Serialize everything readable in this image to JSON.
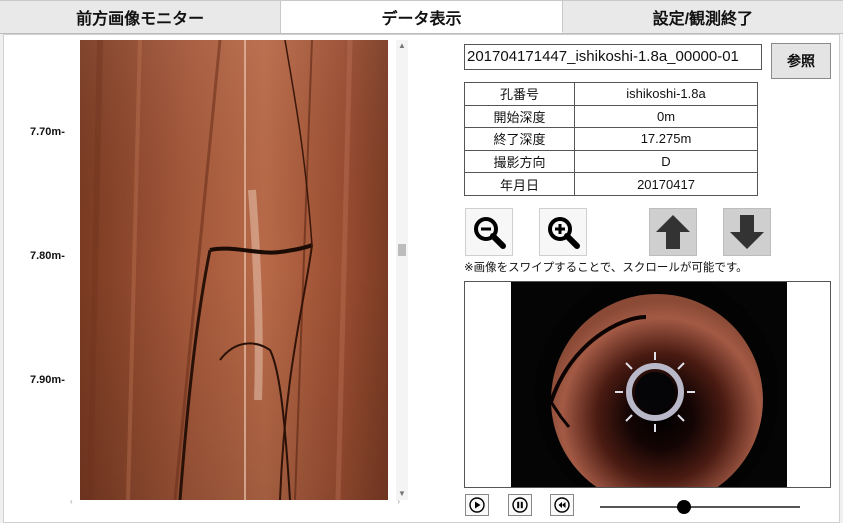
{
  "tabs": [
    {
      "label": "前方画像モニター"
    },
    {
      "label": "データ表示"
    },
    {
      "label": "設定/観測終了"
    }
  ],
  "depth_labels": [
    "7.70m-",
    "7.80m-",
    "7.90m-"
  ],
  "file": {
    "name": "201704171447_ishikoshi-1.8a_00000-01",
    "ref_button": "参照"
  },
  "info_table": [
    {
      "key": "孔番号",
      "value": "ishikoshi-1.8a"
    },
    {
      "key": "開始深度",
      "value": "0m"
    },
    {
      "key": "終了深度",
      "value": "17.275m"
    },
    {
      "key": "撮影方向",
      "value": "D"
    },
    {
      "key": "年月日",
      "value": "20170417"
    }
  ],
  "controls": {
    "zoom_out_icon": "zoom-out-icon",
    "zoom_in_icon": "zoom-in-icon",
    "up_icon": "arrow-up-icon",
    "down_icon": "arrow-down-icon"
  },
  "note": "※画像をスワイプすることで、スクロールが可能です。",
  "playback": {
    "play_icon": "play-icon",
    "pause_icon": "pause-icon",
    "rewind_icon": "rewind-icon",
    "position": 0.42
  }
}
